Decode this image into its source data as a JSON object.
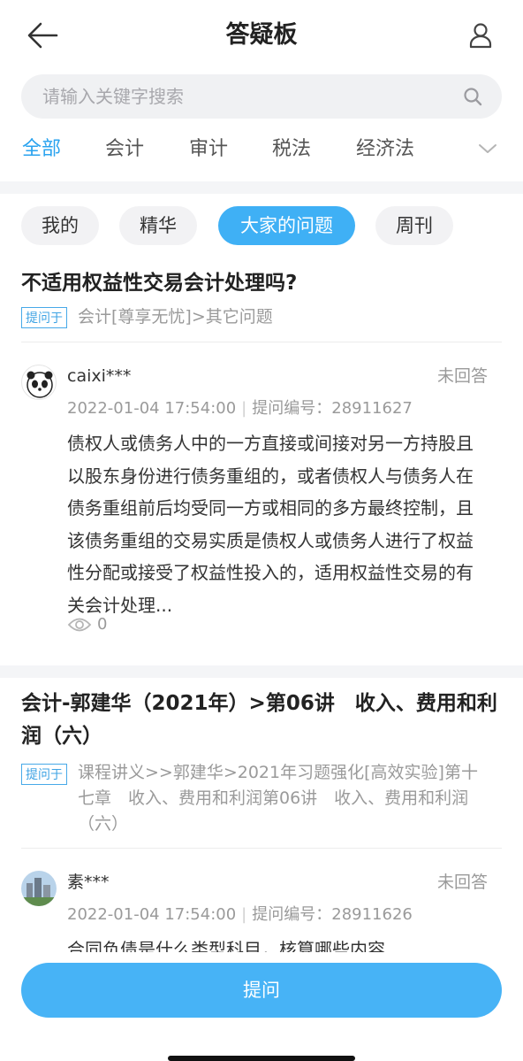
{
  "header": {
    "title": "答疑板"
  },
  "search": {
    "placeholder": "请输入关键字搜索"
  },
  "category_tabs": [
    "全部",
    "会计",
    "审计",
    "税法",
    "经济法"
  ],
  "filters": [
    "我的",
    "精华",
    "大家的问题",
    "周刊"
  ],
  "colors": {
    "accent": "#2aa3ef",
    "button": "#47b3f6"
  },
  "questions": [
    {
      "title": "不适用权益性交易会计处理吗?",
      "tag": "提问于",
      "path": "会计[尊享无忧]>其它问题",
      "user": "caixi***",
      "status": "未回答",
      "time": "2022-01-04 17:54:00",
      "qid": "提问编号：28911627",
      "body": "债权人或债务人中的一方直接或间接对另一方持股且以股东身份进行债务重组的，或者债权人与债务人在债务重组前后均受同一方或相同的多方最终控制，且该债务重组的交易实质是债权人或债务人进行了权益性分配或接受了权益性投入的，适用权益性交易的有关会计处理...",
      "views": "0"
    },
    {
      "title": "会计-郭建华（2021年）>第06讲　收入、费用和利润（六）",
      "tag": "提问于",
      "path": "课程讲义>>郭建华>2021年习题强化[高效实验]第十七章　收入、费用和利润第06讲　收入、费用和利润（六）",
      "user": "素***",
      "status": "未回答",
      "time": "2022-01-04 17:54:00",
      "qid": "提问编号：28911626",
      "body": "合同负债是什么类型科目，核算哪些内容"
    }
  ],
  "ask_button": "提问"
}
